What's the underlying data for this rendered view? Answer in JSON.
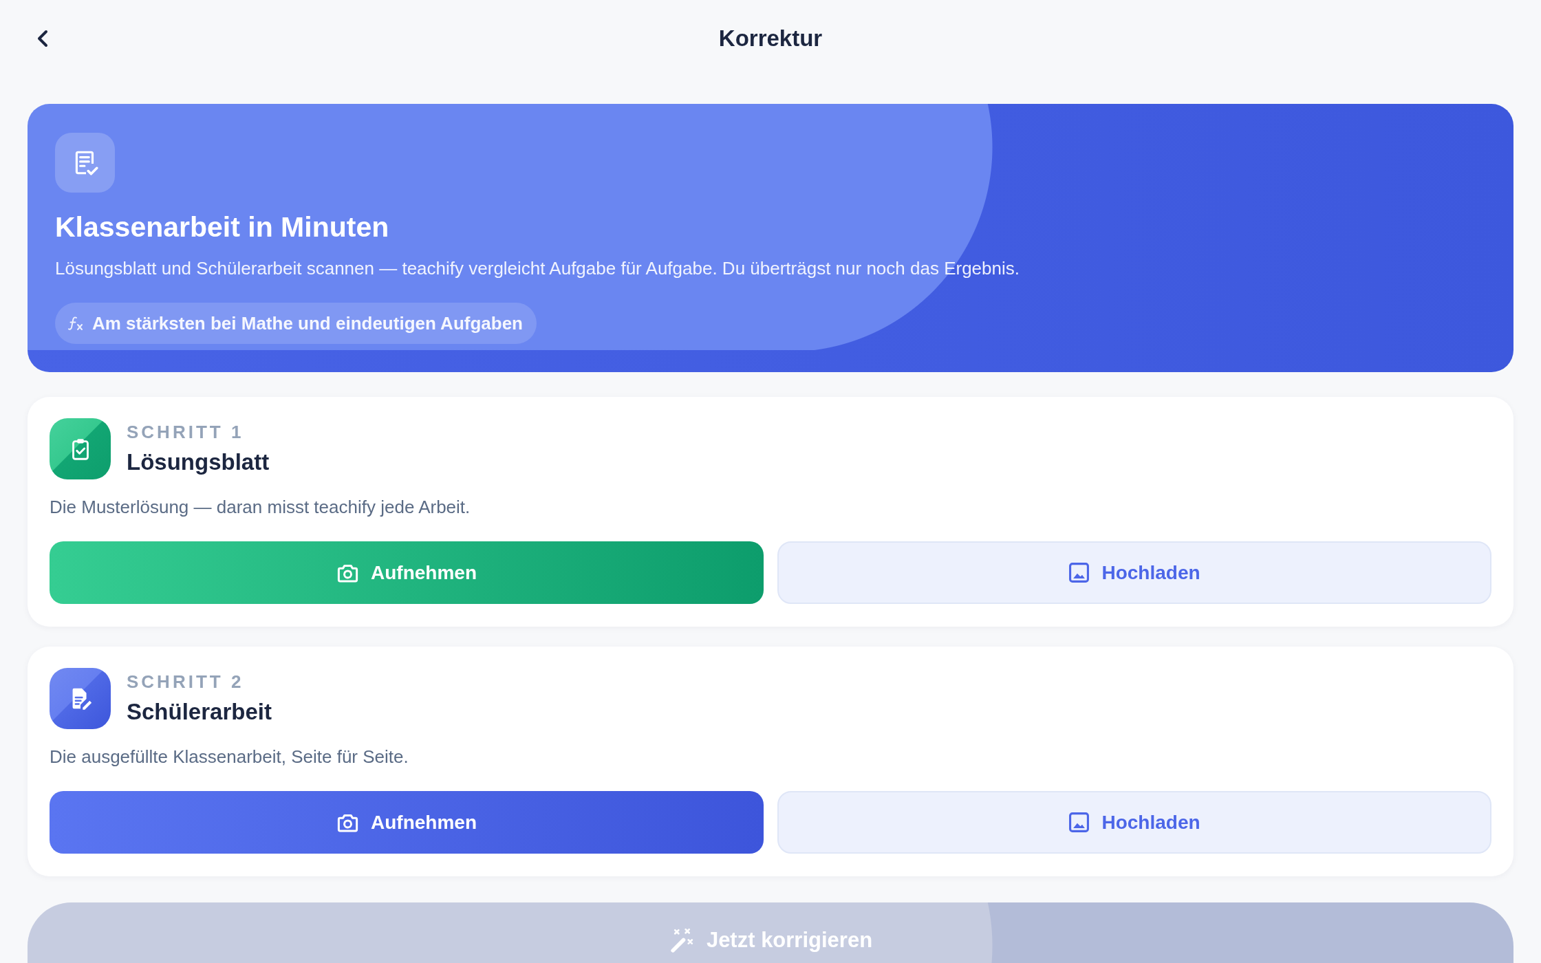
{
  "header": {
    "title": "Korrektur"
  },
  "hero": {
    "title": "Klassenarbeit in Minuten",
    "description": "Lösungsblatt und Schülerarbeit scannen — teachify vergleicht Aufgabe für Aufgabe. Du überträgst nur noch das Ergebnis.",
    "note": "Am stärksten bei Mathe und eindeutigen Aufgaben"
  },
  "steps": [
    {
      "kind": "answer-key",
      "step_label": "SCHRITT 1",
      "title": "Lösungsblatt",
      "description": "Die Musterlösung — daran misst teachify jede Arbeit.",
      "buttons": [
        {
          "kind": "capture",
          "label": "Aufnehmen"
        },
        {
          "kind": "upload",
          "label": "Hochladen"
        }
      ]
    },
    {
      "kind": "student-work",
      "step_label": "SCHRITT 2",
      "title": "Schülerarbeit",
      "description": "Die ausgefüllte Klassenarbeit, Seite für Seite.",
      "buttons": [
        {
          "kind": "capture",
          "label": "Aufnehmen"
        },
        {
          "kind": "upload",
          "label": "Hochladen"
        }
      ]
    }
  ],
  "submit_button": {
    "label": "Jetzt korrigieren",
    "disabled": true
  }
}
